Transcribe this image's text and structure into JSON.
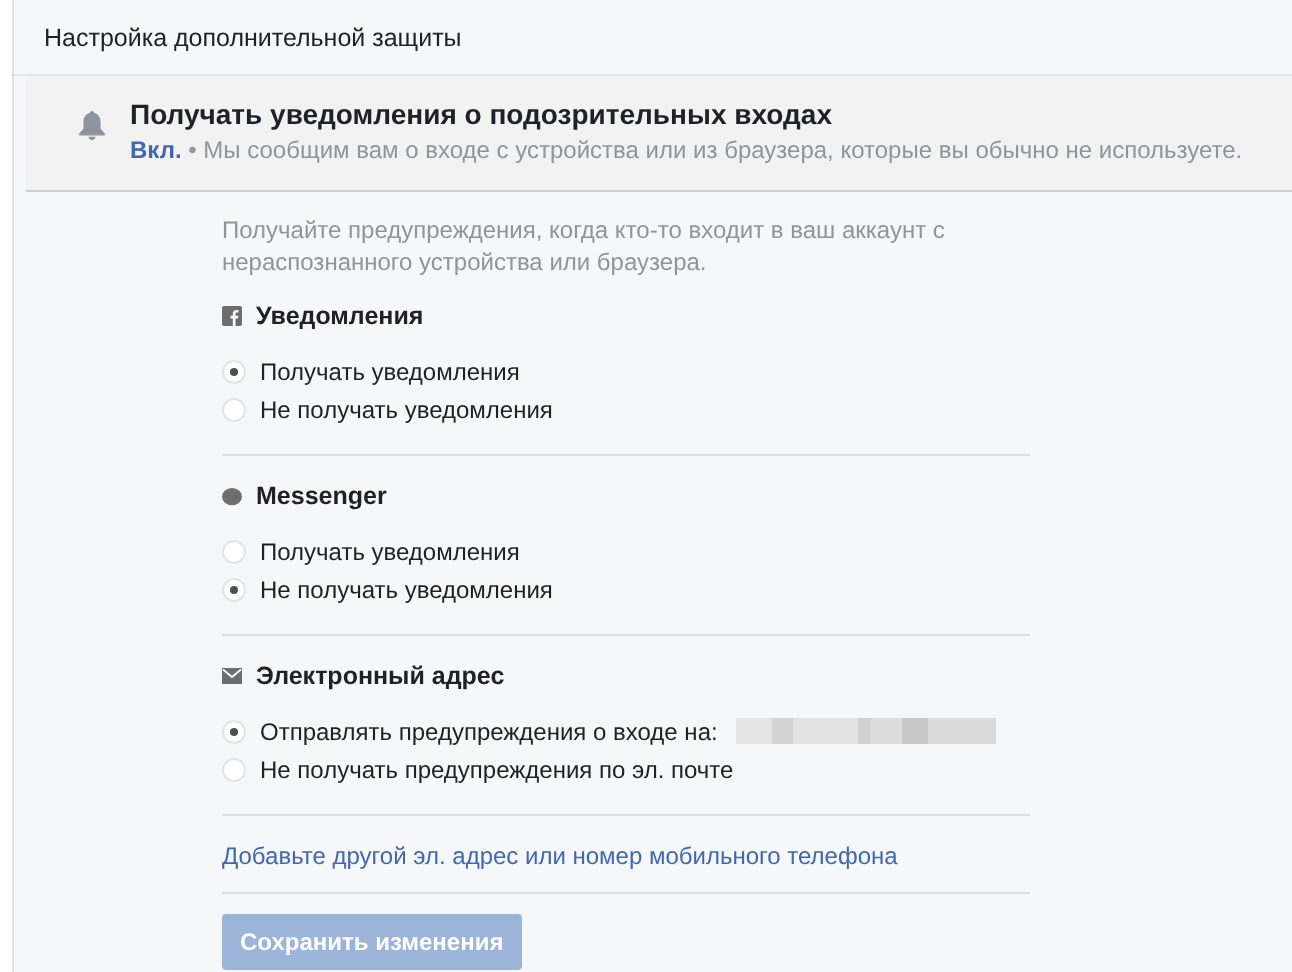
{
  "header": {
    "title": "Настройка дополнительной защиты"
  },
  "alert": {
    "title": "Получать уведомления о подозрительных входах",
    "status": "Вкл.",
    "separator": "•",
    "description": "Мы сообщим вам о входе с устройства или из браузера, которые вы обычно не используете."
  },
  "intro": "Получайте предупреждения, когда кто-то входит в ваш аккаунт с нераспознанного устройства или браузера.",
  "channels": [
    {
      "kind": "facebook",
      "title": "Уведомления",
      "options": [
        {
          "label": "Получать уведомления",
          "selected": true
        },
        {
          "label": "Не получать уведомления",
          "selected": false
        }
      ]
    },
    {
      "kind": "messenger",
      "title": "Messenger",
      "options": [
        {
          "label": "Получать уведомления",
          "selected": false
        },
        {
          "label": "Не получать уведомления",
          "selected": true
        }
      ]
    },
    {
      "kind": "email",
      "title": "Электронный адрес",
      "options": [
        {
          "label": "Отправлять предупреждения о входе на:",
          "selected": true,
          "redacted": true
        },
        {
          "label": "Не получать предупреждения по эл. почте",
          "selected": false
        }
      ]
    }
  ],
  "add_link": "Добавьте другой эл. адрес или номер мобильного телефона",
  "save_button": {
    "label": "Сохранить изменения",
    "disabled": true
  }
}
